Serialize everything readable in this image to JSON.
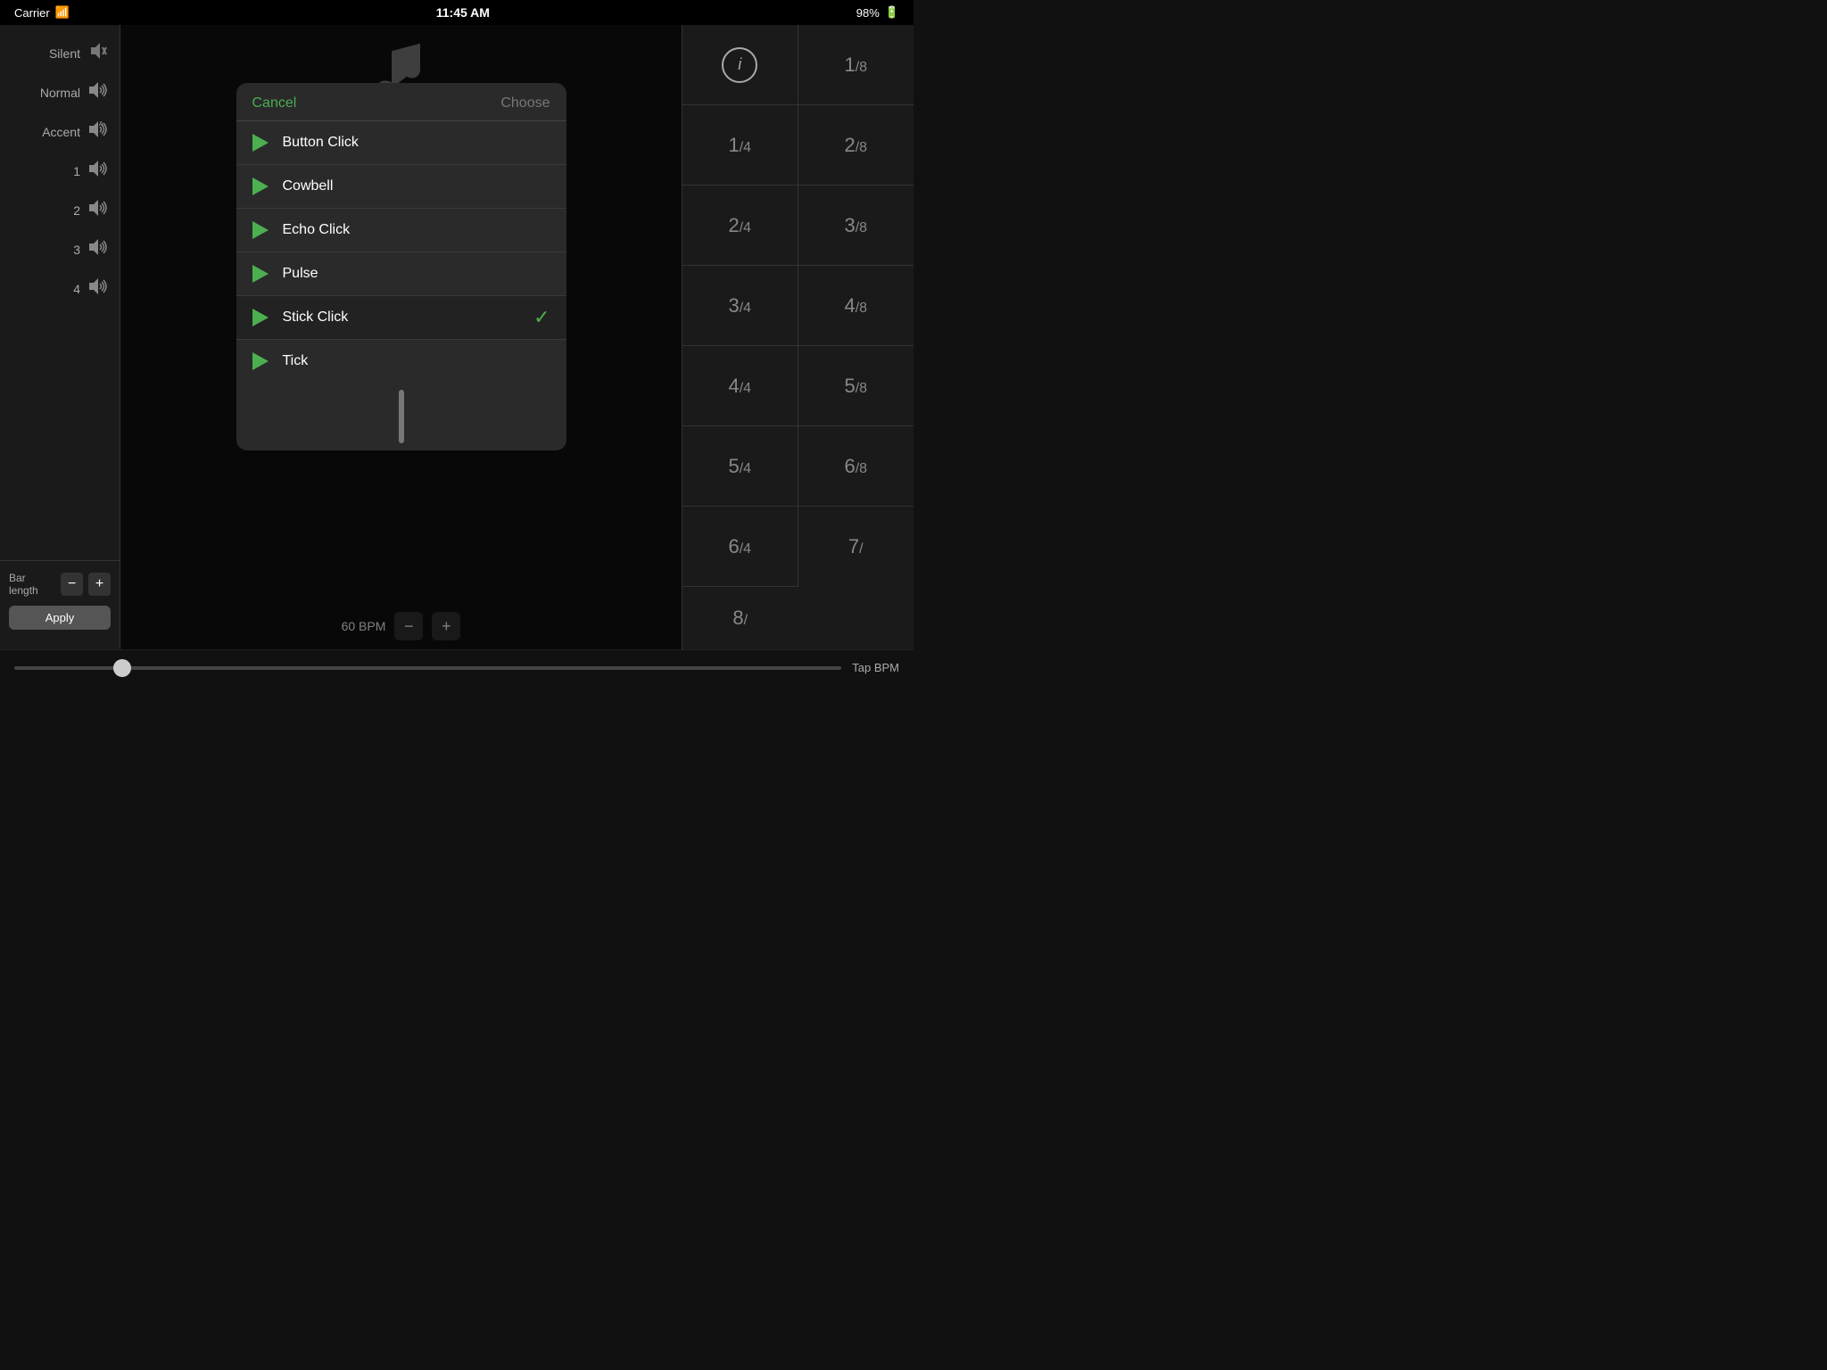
{
  "statusBar": {
    "carrier": "Carrier",
    "time": "11:45 AM",
    "battery": "98%"
  },
  "leftPanel": {
    "items": [
      {
        "label": "Silent",
        "icon": "🔇"
      },
      {
        "label": "Normal",
        "icon": "🔊"
      },
      {
        "label": "Accent",
        "icon": "🔊"
      },
      {
        "label": "1",
        "icon": "🔊"
      },
      {
        "label": "2",
        "icon": "🔊"
      },
      {
        "label": "3",
        "icon": "🔊"
      },
      {
        "label": "4",
        "icon": "🔊"
      }
    ],
    "barLength": "Bar length",
    "decrementLabel": "−",
    "incrementLabel": "+",
    "applyLabel": "Apply"
  },
  "modal": {
    "cancelLabel": "Cancel",
    "chooseLabel": "Choose",
    "items": [
      {
        "name": "Button Click",
        "selected": false
      },
      {
        "name": "Cowbell",
        "selected": false
      },
      {
        "name": "Echo Click",
        "selected": false
      },
      {
        "name": "Pulse",
        "selected": false
      },
      {
        "name": "Stick Click",
        "selected": true
      },
      {
        "name": "Tick",
        "selected": false
      }
    ]
  },
  "bpm": {
    "value": "60 BPM",
    "decrementLabel": "−",
    "incrementLabel": "+"
  },
  "tapBpm": {
    "label": "Tap BPM"
  },
  "rightPanel": {
    "cells": [
      {
        "top": "1",
        "slash": "/",
        "bot": "8"
      },
      {
        "top": "1",
        "slash": "/",
        "bot": "4"
      },
      {
        "top": "2",
        "slash": "/",
        "bot": "8"
      },
      {
        "top": "2",
        "slash": "/",
        "bot": "4"
      },
      {
        "top": "3",
        "slash": "/",
        "bot": "8"
      },
      {
        "top": "3",
        "slash": "/",
        "bot": "4"
      },
      {
        "top": "4",
        "slash": "/",
        "bot": "8"
      },
      {
        "top": "4",
        "slash": "/",
        "bot": "4"
      },
      {
        "top": "5",
        "slash": "/",
        "bot": "8"
      },
      {
        "top": "5",
        "slash": "/",
        "bot": "4"
      },
      {
        "top": "6",
        "slash": "/",
        "bot": "8"
      },
      {
        "top": "6",
        "slash": "/",
        "bot": "4"
      },
      {
        "top": "7",
        "slash": "/",
        "bot": ""
      },
      {
        "top": "8",
        "slash": "/",
        "bot": ""
      }
    ]
  }
}
